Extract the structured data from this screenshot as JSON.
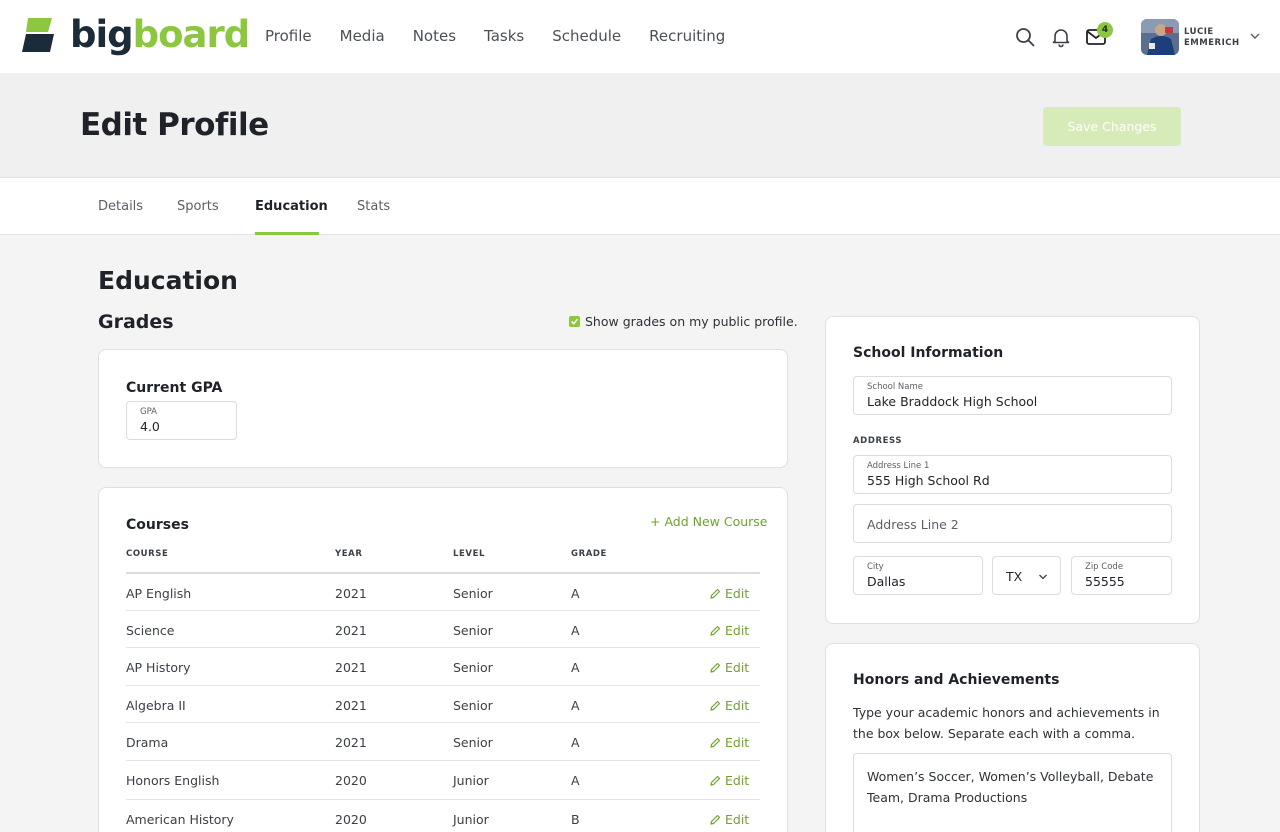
{
  "brand": {
    "big": "big",
    "board": "board",
    "accent": "#8dc63f",
    "dark": "#1b2b3a"
  },
  "nav": {
    "items": [
      "Profile",
      "Media",
      "Notes",
      "Tasks",
      "Schedule",
      "Recruiting"
    ],
    "icons": [
      "search-icon",
      "bell-icon",
      "mail-icon"
    ],
    "mail_badge": "4",
    "user_first": "LUCIE",
    "user_last": "EMMERICH"
  },
  "header": {
    "title": "Edit Profile",
    "save_label": "Save Changes"
  },
  "tabs": {
    "items": [
      "Details",
      "Sports",
      "Education",
      "Stats"
    ],
    "active": "Education"
  },
  "education": {
    "title": "Education",
    "grades_title": "Grades",
    "show_grades_label": "Show grades on my public profile.",
    "show_grades_checked": true,
    "gpa": {
      "title": "Current GPA",
      "label": "GPA",
      "value": "4.0"
    }
  },
  "courses": {
    "title": "Courses",
    "add_label": "+ Add New Course",
    "edit_label": "Edit",
    "columns": [
      "COURSE",
      "YEAR",
      "LEVEL",
      "GRADE"
    ],
    "rows": [
      {
        "course": "AP English",
        "year": "2021",
        "level": "Senior",
        "grade": "A"
      },
      {
        "course": "Science",
        "year": "2021",
        "level": "Senior",
        "grade": "A"
      },
      {
        "course": "AP History",
        "year": "2021",
        "level": "Senior",
        "grade": "A"
      },
      {
        "course": "Algebra II",
        "year": "2021",
        "level": "Senior",
        "grade": "A"
      },
      {
        "course": "Drama",
        "year": "2021",
        "level": "Senior",
        "grade": "A"
      },
      {
        "course": "Honors English",
        "year": "2020",
        "level": "Junior",
        "grade": "A"
      },
      {
        "course": "American History",
        "year": "2020",
        "level": "Junior",
        "grade": "B"
      }
    ]
  },
  "school": {
    "title": "School Information",
    "name_label": "School Name",
    "name_value": "Lake Braddock High School",
    "address_label": "ADDRESS",
    "line1_label": "Address Line 1",
    "line1_value": "555 High School Rd",
    "line2_placeholder": "Address Line 2",
    "city_label": "City",
    "city_value": "Dallas",
    "state_value": "TX",
    "zip_label": "Zip Code",
    "zip_value": "55555"
  },
  "honors": {
    "title": "Honors and Achievements",
    "description": "Type your academic honors and achievements in the box below. Separate each with a comma.",
    "value": "Women’s Soccer, Women’s Volleyball, Debate Team, Drama Productions"
  }
}
